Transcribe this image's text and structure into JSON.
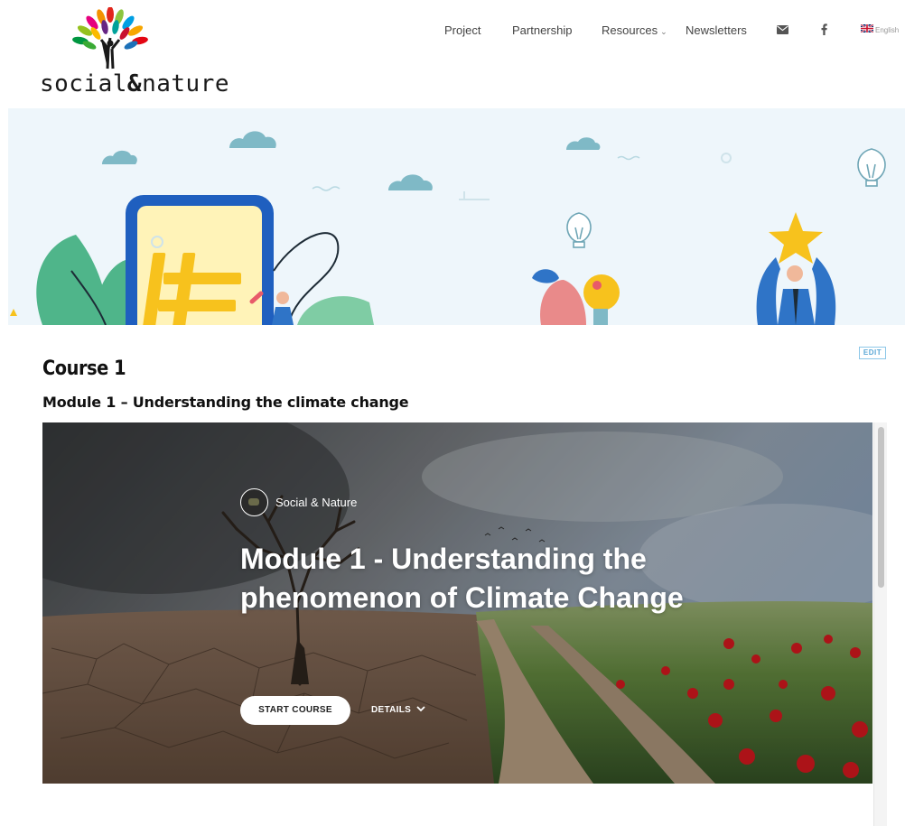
{
  "header": {
    "logo_text_left": "social",
    "logo_text_right": "nature",
    "nav": [
      {
        "label": "Project"
      },
      {
        "label": "Partnership"
      },
      {
        "label": "Resources",
        "has_dropdown": true
      },
      {
        "label": "Newsletters"
      }
    ],
    "icons": [
      "mail-icon",
      "facebook-icon",
      "uk-flag-icon"
    ],
    "language_label": "English"
  },
  "banner": {
    "colors": {
      "sky": "#eef6fb",
      "cloud": "#7fb9c6",
      "phone_frame": "#1f5fbf",
      "phone_screen": "#fff3b8",
      "hash": "#f7c21d",
      "leaf": "#4fb58a",
      "star": "#f7c21d",
      "suit": "#2f74c7"
    }
  },
  "course": {
    "edit_label": "EDIT",
    "title": "Course 1",
    "module_subtitle": "Module 1 – Understanding the climate change"
  },
  "card": {
    "author": "Social & Nature",
    "heading": "Module 1 - Understanding the phenomenon of Climate Change",
    "start_label": "START COURSE",
    "details_label": "DETAILS"
  }
}
